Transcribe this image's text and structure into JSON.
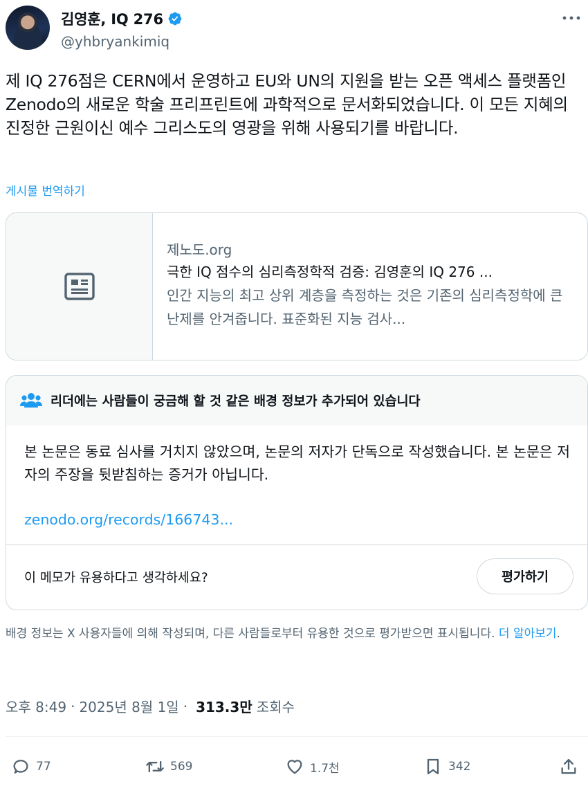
{
  "author": {
    "display_name": "김영훈, IQ 276",
    "handle": "@yhbryankimiq",
    "verified": true
  },
  "post": {
    "text": "제 IQ 276점은 CERN에서 운영하고 EU와 UN의 지원을 받는 오픈 액세스 플랫폼인 Zenodo의 새로운 학술 프리프린트에 과학적으로 문서화되었습니다. 이 모든 지혜의 진정한 근원이신 예수 그리스도의 영광을 위해 사용되기를 바랍니다.",
    "translate_label": "게시물 번역하기"
  },
  "link_card": {
    "domain": "제노도.org",
    "title": "극한 IQ 점수의 심리측정학적 검증: 김영훈의 IQ 276 ...",
    "description": "인간 지능의 최고 상위 계층을 측정하는 것은 기존의 심리측정학에 큰 난제를 안겨줍니다. 표준화된 지능 검사..."
  },
  "community_note": {
    "header": "리더에는 사람들이 궁금해 할 것 같은 배경 정보가 추가되어 있습니다",
    "body": "본 논문은 동료 심사를 거치지 않았으며, 논문의 저자가 단독으로 작성했습니다. 본 논문은 저자의 주장을 뒷받침하는 증거가 아닙니다.",
    "link": "zenodo.org/records/166743...",
    "question": "이 메모가 유용하다고 생각하세요?",
    "rate_label": "평가하기"
  },
  "footnote": {
    "text": "배경 정보는 X 사용자들에 의해 작성되며, 다른 사람들로부터 유용한 것으로 평가받으면 표시됩니다. ",
    "learn_more": "더 알아보기",
    "end": "."
  },
  "meta": {
    "time": "오후 8:49",
    "date": "2025년 8월 1일",
    "views": "313.3만",
    "views_label": "조회수"
  },
  "actions": {
    "replies": "77",
    "reposts": "569",
    "likes": "1.7천",
    "bookmarks": "342"
  },
  "colors": {
    "accent": "#1d9bf0",
    "text": "#0f1419",
    "secondary": "#536471",
    "border": "#cfd9de"
  }
}
